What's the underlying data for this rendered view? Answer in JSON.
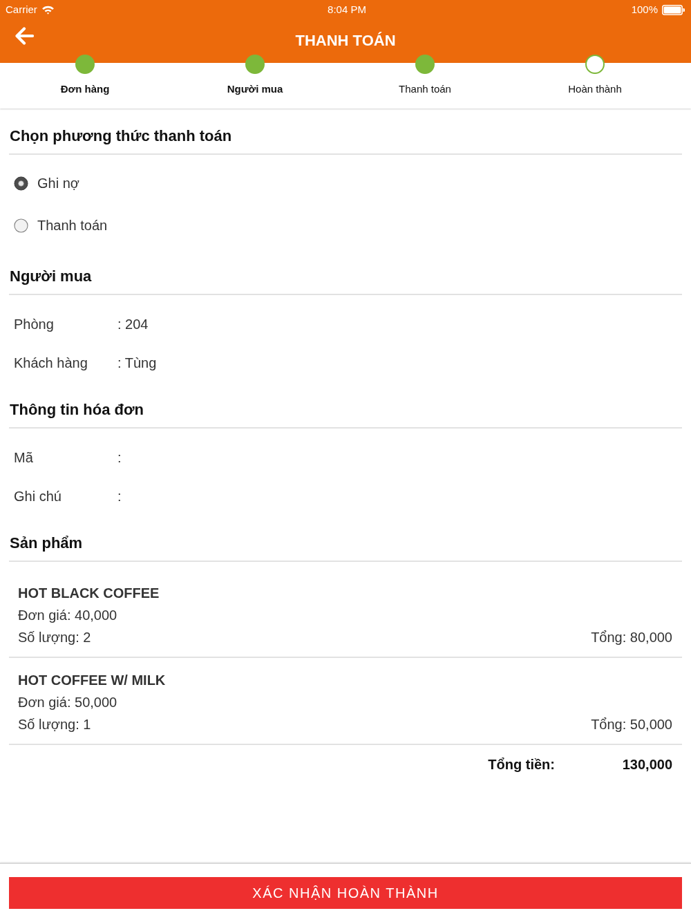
{
  "status_bar": {
    "carrier": "Carrier",
    "time": "8:04 PM",
    "battery": "100%"
  },
  "nav_bar": {
    "title": "THANH TOÁN"
  },
  "steps": [
    {
      "label": "Đơn hàng",
      "kind": "completed"
    },
    {
      "label": "Người mua",
      "kind": "completed"
    },
    {
      "label": "Thanh toán",
      "kind": "current"
    },
    {
      "label": "Hoàn thành",
      "kind": "pending"
    }
  ],
  "payment_method": {
    "heading": "Chọn phương thức thanh toán",
    "options": [
      {
        "label": "Ghi nợ",
        "selected": true
      },
      {
        "label": "Thanh toán",
        "selected": false
      }
    ]
  },
  "buyer": {
    "heading": "Người mua",
    "fields": [
      {
        "label": "Phòng",
        "value": ": 204"
      },
      {
        "label": "Khách hàng",
        "value": ": Tùng"
      }
    ]
  },
  "invoice": {
    "heading": "Thông tin hóa đơn",
    "fields": [
      {
        "label": "Mã",
        "value": ":"
      },
      {
        "label": "Ghi chú",
        "value": ":"
      }
    ]
  },
  "products": {
    "heading": "Sản phẩm",
    "items": [
      {
        "name": "HOT BLACK COFFEE",
        "unit_price": "Đơn giá: 40,000",
        "quantity": "Số lượng: 2",
        "total": "Tổng: 80,000"
      },
      {
        "name": "HOT COFFEE W/ MILK",
        "unit_price": "Đơn giá: 50,000",
        "quantity": "Số lượng: 1",
        "total": "Tổng: 50,000"
      }
    ],
    "grand_total_label": "Tổng tiền:",
    "grand_total": "130,000"
  },
  "confirm_button": "XÁC NHẬN HOÀN THÀNH"
}
